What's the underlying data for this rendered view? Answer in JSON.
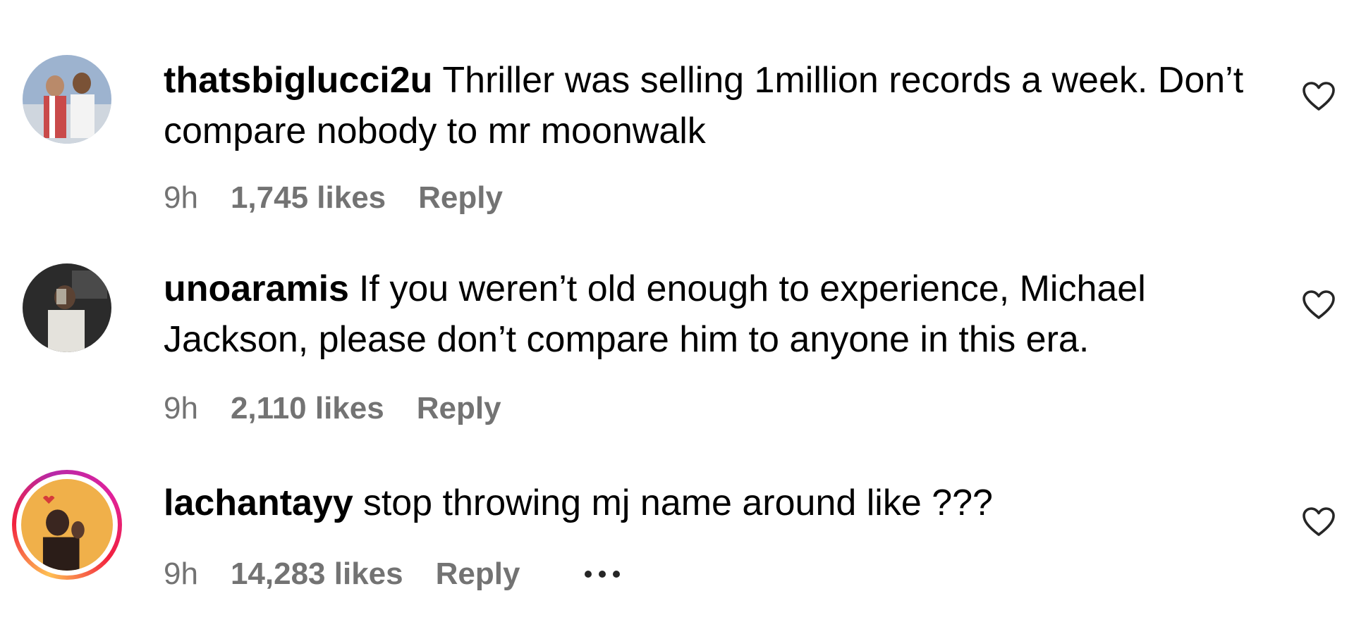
{
  "comments": [
    {
      "username": "thatsbiglucci2u",
      "text": "Thriller was selling 1million records a week. Don’t compare nobody to mr moonwalk",
      "time": "9h",
      "likes": "1,745 likes",
      "reply": "Reply",
      "heart_icon": "heart-outline-icon",
      "avatar_colors": [
        "#7a93b8",
        "#c9d6e6",
        "#e8d7c4"
      ]
    },
    {
      "username": "unoaramis",
      "text": "If you weren’t old enough to experience, Michael Jackson, please don’t compare him to anyone in this era.",
      "time": "9h",
      "likes": "2,110 likes",
      "reply": "Reply",
      "heart_icon": "heart-outline-icon",
      "avatar_colors": [
        "#2a2a2a",
        "#d9d9d4",
        "#5a4a40"
      ]
    },
    {
      "username": "lachantayy",
      "text": "stop throwing mj name around like ???",
      "time": "9h",
      "likes": "14,283 likes",
      "reply": "Reply",
      "heart_icon": "heart-outline-icon",
      "more_icon": "more-options-icon",
      "has_story_ring": true,
      "avatar_colors": [
        "#f0b04a",
        "#2b1d18",
        "#c64a3c"
      ]
    }
  ],
  "colors": {
    "text": "#000000",
    "meta": "#737373",
    "story_ring": [
      "#fec053",
      "#f2203e",
      "#b729a8"
    ]
  }
}
